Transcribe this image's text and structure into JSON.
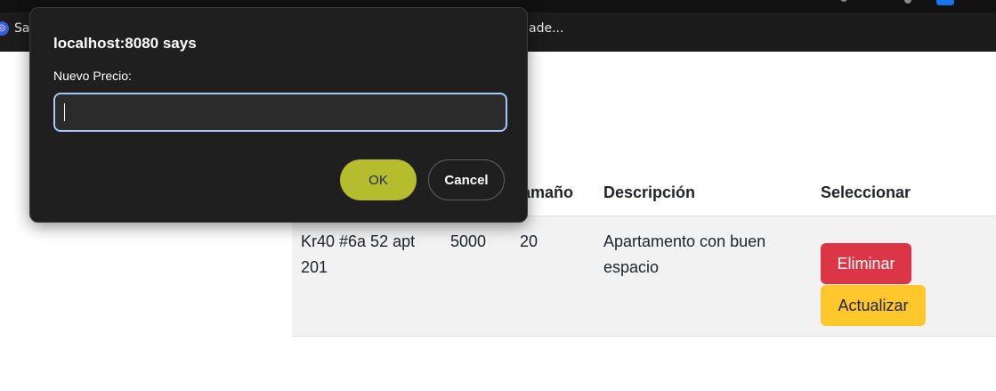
{
  "browser": {
    "bookmark_left": "Sa",
    "bookmark_right": "ade..."
  },
  "dialog": {
    "title": "localhost:8080 says",
    "message": "Nuevo Precio:",
    "input_value": "",
    "ok_label": "OK",
    "cancel_label": "Cancel",
    "ok_color": "#b5bd2e"
  },
  "table": {
    "headers": {
      "tamano": "amaño",
      "descripcion": "Descripción",
      "seleccionar": "Seleccionar"
    },
    "rows": [
      {
        "direccion_line1": "Kr40 #6a 52 apt",
        "direccion_line2": "201",
        "precio": "5000",
        "tamano": "20",
        "descripcion_line1": "Apartamento con buen",
        "descripcion_line2": "espacio",
        "eliminar_label": "Eliminar",
        "actualizar_label": "Actualizar"
      }
    ]
  },
  "colors": {
    "danger": "#dc3545",
    "warning": "#ffc72c",
    "dialog_bg": "#1f1f1f",
    "input_focus": "#a8c7fa"
  }
}
